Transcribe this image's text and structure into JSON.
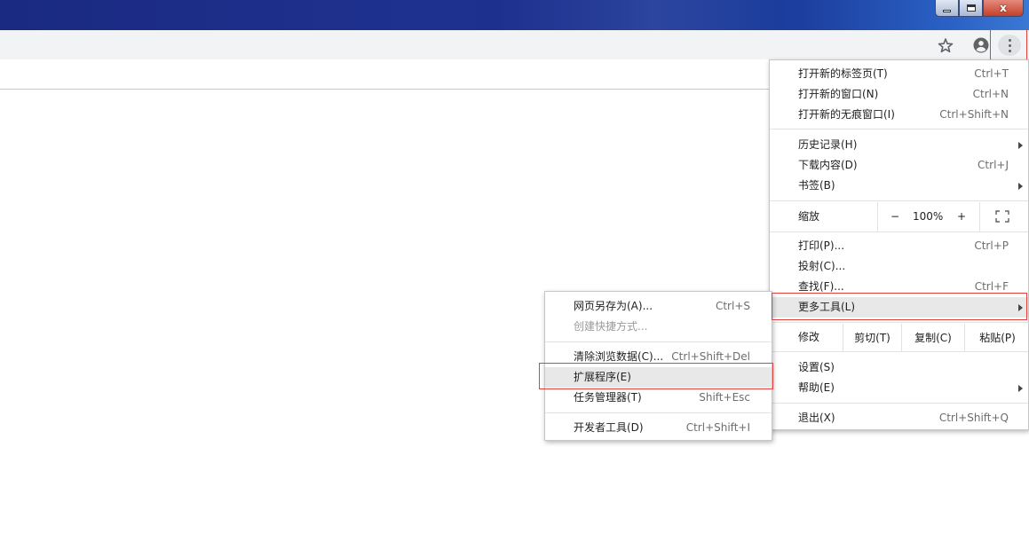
{
  "window": {
    "minimize_glyph": "",
    "maximize_glyph": "",
    "close_glyph": "x"
  },
  "toolbar": {
    "bookmark_icon": "star-icon",
    "profile_icon": "account-circle-icon",
    "menu_icon": "vertical-dots-icon"
  },
  "main_menu": {
    "new_tab": {
      "label": "打开新的标签页(T)",
      "shortcut": "Ctrl+T"
    },
    "new_window": {
      "label": "打开新的窗口(N)",
      "shortcut": "Ctrl+N"
    },
    "incognito": {
      "label": "打开新的无痕窗口(I)",
      "shortcut": "Ctrl+Shift+N"
    },
    "history": {
      "label": "历史记录(H)"
    },
    "downloads": {
      "label": "下载内容(D)",
      "shortcut": "Ctrl+J"
    },
    "bookmarks": {
      "label": "书签(B)"
    },
    "zoom": {
      "label": "缩放",
      "minus": "−",
      "value": "100%",
      "plus": "+"
    },
    "print": {
      "label": "打印(P)...",
      "shortcut": "Ctrl+P"
    },
    "cast": {
      "label": "投射(C)..."
    },
    "find": {
      "label": "查找(F)...",
      "shortcut": "Ctrl+F"
    },
    "more_tools": {
      "label": "更多工具(L)"
    },
    "edit": {
      "label": "修改",
      "cut": "剪切(T)",
      "copy": "复制(C)",
      "paste": "粘贴(P)"
    },
    "settings": {
      "label": "设置(S)"
    },
    "help": {
      "label": "帮助(E)"
    },
    "exit": {
      "label": "退出(X)",
      "shortcut": "Ctrl+Shift+Q"
    }
  },
  "sub_menu": {
    "save_page": {
      "label": "网页另存为(A)...",
      "shortcut": "Ctrl+S"
    },
    "create_shortcut": {
      "label": "创建快捷方式..."
    },
    "clear_data": {
      "label": "清除浏览数据(C)...",
      "shortcut": "Ctrl+Shift+Del"
    },
    "extensions": {
      "label": "扩展程序(E)"
    },
    "task_manager": {
      "label": "任务管理器(T)",
      "shortcut": "Shift+Esc"
    },
    "dev_tools": {
      "label": "开发者工具(D)",
      "shortcut": "Ctrl+Shift+I"
    }
  },
  "colors": {
    "highlight_border": "#e0423b",
    "active_row": "#e8e8e8",
    "toolbar_bg": "#f1f3f4",
    "titlebar": "#1f318f"
  }
}
